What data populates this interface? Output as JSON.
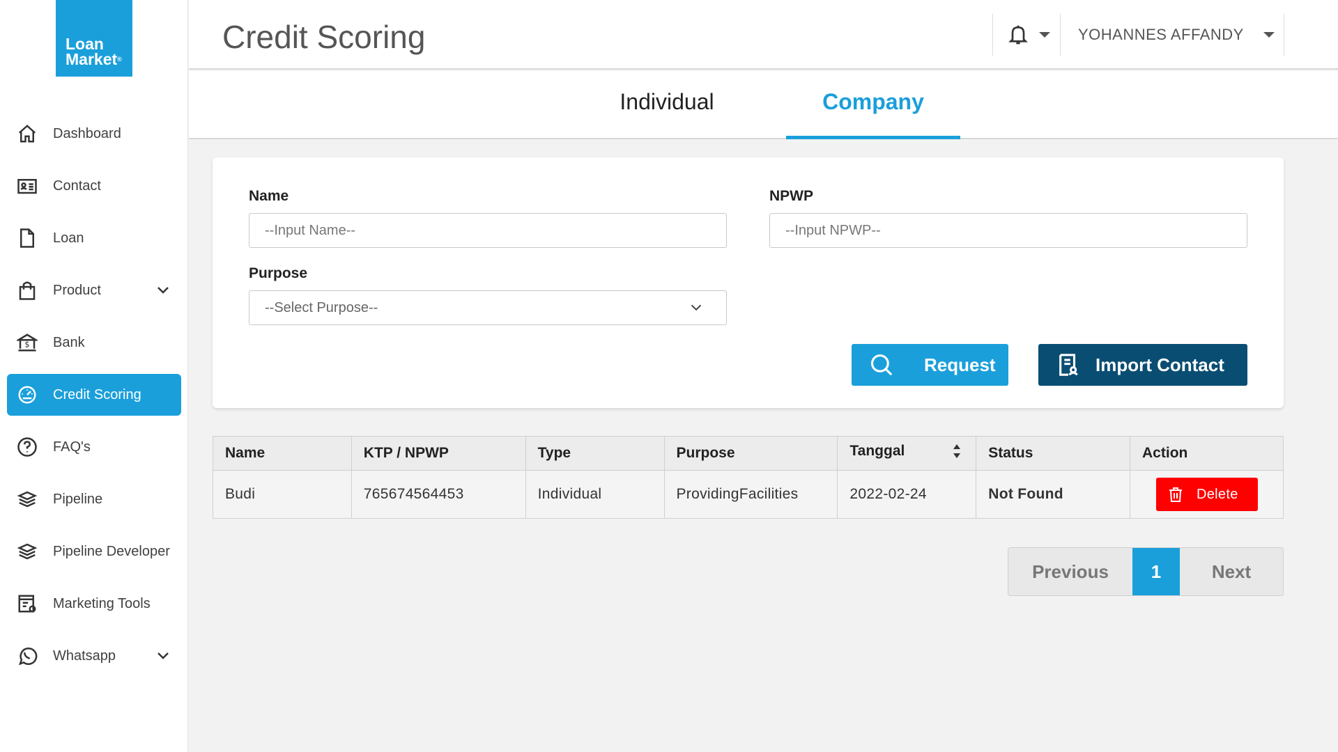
{
  "brand": {
    "line1": "Loan",
    "line2": "Market",
    "tm": "®",
    "color": "#1a9fdb"
  },
  "sidebar": {
    "items": [
      {
        "label": "Dashboard",
        "icon": "home-icon"
      },
      {
        "label": "Contact",
        "icon": "contact-card-icon"
      },
      {
        "label": "Loan",
        "icon": "document-icon"
      },
      {
        "label": "Product",
        "icon": "shopping-bag-icon",
        "expandable": true
      },
      {
        "label": "Bank",
        "icon": "bank-icon"
      },
      {
        "label": "Credit Scoring",
        "icon": "speedometer-icon",
        "active": true
      },
      {
        "label": "FAQ's",
        "icon": "question-circle-icon"
      },
      {
        "label": "Pipeline",
        "icon": "layers-icon"
      },
      {
        "label": "Pipeline Developer",
        "icon": "layers-icon"
      },
      {
        "label": "Marketing Tools",
        "icon": "tools-settings-icon"
      },
      {
        "label": "Whatsapp",
        "icon": "whatsapp-icon",
        "expandable": true
      }
    ]
  },
  "header": {
    "title": "Credit Scoring",
    "user_name": "YOHANNES AFFANDY"
  },
  "tabs": {
    "individual": "Individual",
    "company": "Company",
    "active": "Company"
  },
  "form": {
    "name_label": "Name",
    "name_placeholder": "--Input Name--",
    "npwp_label": "NPWP",
    "npwp_placeholder": "--Input NPWP--",
    "purpose_label": "Purpose",
    "purpose_value": "--Select Purpose--",
    "request_label": "Request",
    "import_label": "Import Contact"
  },
  "table": {
    "headers": [
      "Name",
      "KTP / NPWP",
      "Type",
      "Purpose",
      "Tanggal",
      "Status",
      "Action"
    ],
    "rows": [
      {
        "name": "Budi",
        "ktp_npwp": "765674564453",
        "type": "Individual",
        "purpose": "ProvidingFacilities",
        "tanggal": "2022-02-24",
        "status": "Not Found",
        "action": "Delete"
      }
    ]
  },
  "pagination": {
    "previous": "Previous",
    "current": "1",
    "next": "Next"
  },
  "colors": {
    "accent": "#1a9fdb",
    "dark_button": "#0a4d73",
    "danger": "#ff0000",
    "status_not_found": "#e51b1b"
  }
}
